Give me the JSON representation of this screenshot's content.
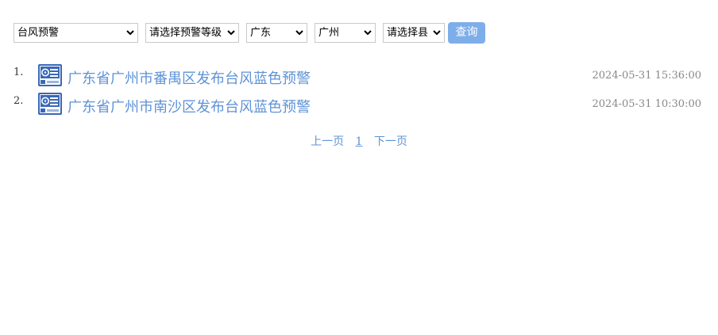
{
  "filters": {
    "type_select": "台风预警",
    "level_select": "请选择预警等级",
    "province_select": "广东",
    "city_select": "广州",
    "county_select": "请选择县",
    "query_button": "查询"
  },
  "colors": {
    "link": "#5e93d6",
    "button_bg": "#7eaeea",
    "icon_blue": "#3a68b8",
    "time_text": "#888888"
  },
  "warnings": [
    {
      "index": "1.",
      "icon": "typhoon-blue-warning-icon",
      "title": "广东省广州市番禺区发布台风蓝色预警",
      "time": "2024-05-31 15:36:00"
    },
    {
      "index": "2.",
      "icon": "typhoon-blue-warning-icon",
      "title": "广东省广州市南沙区发布台风蓝色预警",
      "time": "2024-05-31 10:30:00"
    }
  ],
  "pagination": {
    "prev_label": "上一页",
    "current_page": "1",
    "next_label": "下一页"
  }
}
